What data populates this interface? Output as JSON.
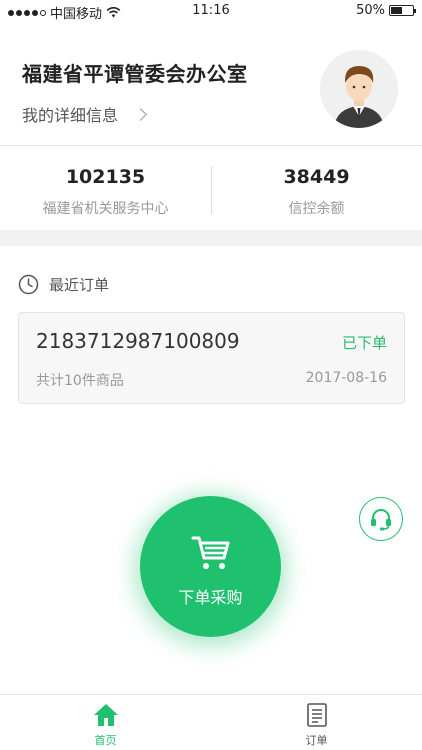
{
  "status_bar": {
    "carrier": "中国移动",
    "time": "11:16",
    "battery": "50%",
    "battery_level": 0.5,
    "signal_bars": 4
  },
  "profile": {
    "org_name": "福建省平谭管委会办公室",
    "detail_link": "我的详细信息",
    "avatar_icon": "user-avatar-icon"
  },
  "stats": [
    {
      "value": "102135",
      "label": "福建省机关服务中心"
    },
    {
      "value": "38449",
      "label": "信控余额"
    }
  ],
  "recent_orders": {
    "title": "最近订单",
    "icon": "clock-icon",
    "order": {
      "number": "2183712987100809",
      "status": "已下单",
      "count": "共计10件商品",
      "date": "2017-08-16"
    }
  },
  "cta": {
    "label": "下单采购",
    "icon": "cart-icon"
  },
  "service": {
    "icon": "headset-icon"
  },
  "tabbar": {
    "tabs": [
      {
        "label": "首页",
        "icon": "home-icon",
        "active": true
      },
      {
        "label": "订单",
        "icon": "document-icon",
        "active": false
      }
    ]
  },
  "colors": {
    "accent": "#1fc06e",
    "status_green": "#27bd6b"
  }
}
